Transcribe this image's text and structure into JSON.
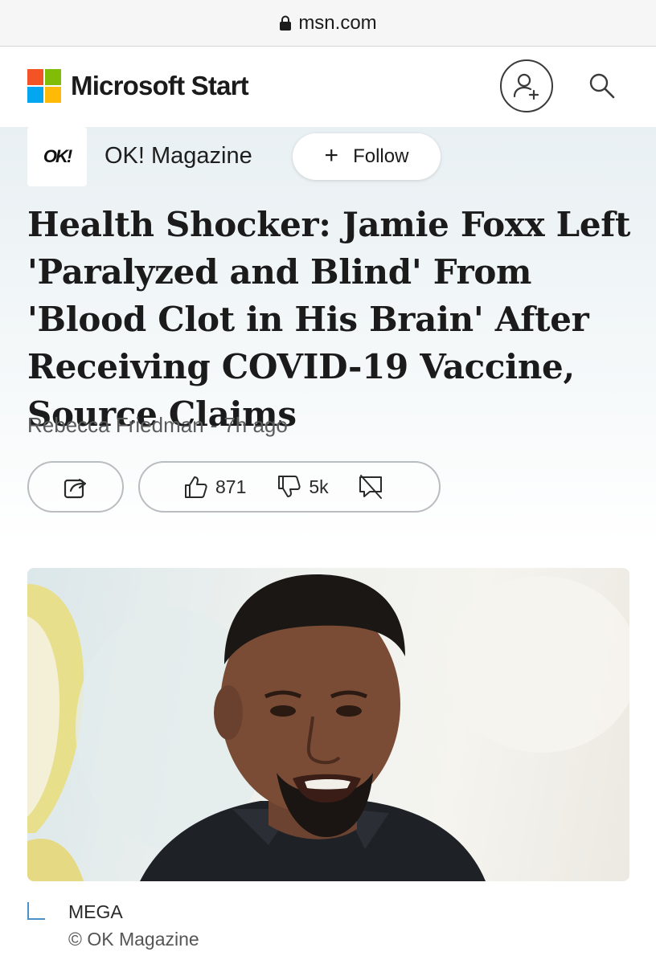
{
  "browser": {
    "domain": "msn.com",
    "lock_icon": "lock-icon"
  },
  "header": {
    "brand_name": "Microsoft Start",
    "logo_colors": [
      "#f35325",
      "#81bc06",
      "#05a6f0",
      "#ffba08"
    ],
    "profile_icon": "add-user-icon",
    "search_icon": "search-icon"
  },
  "article": {
    "publisher": {
      "logo_text": "OK!",
      "name": "OK! Magazine",
      "follow_label": "Follow"
    },
    "headline": "Health Shocker: Jamie Foxx Left 'Paralyzed and Blind' From 'Blood Clot in His Brain' After Receiving COVID-19 Vaccine, Source Claims",
    "author": "Rebecca Friedman",
    "separator": "-",
    "time": "7h ago",
    "reactions": {
      "share_icon": "share-icon",
      "likes": "871",
      "dislikes": "5k",
      "comments_icon": "comments-off-icon"
    },
    "image": {
      "source": "MEGA",
      "credit": "© OK Magazine"
    }
  }
}
